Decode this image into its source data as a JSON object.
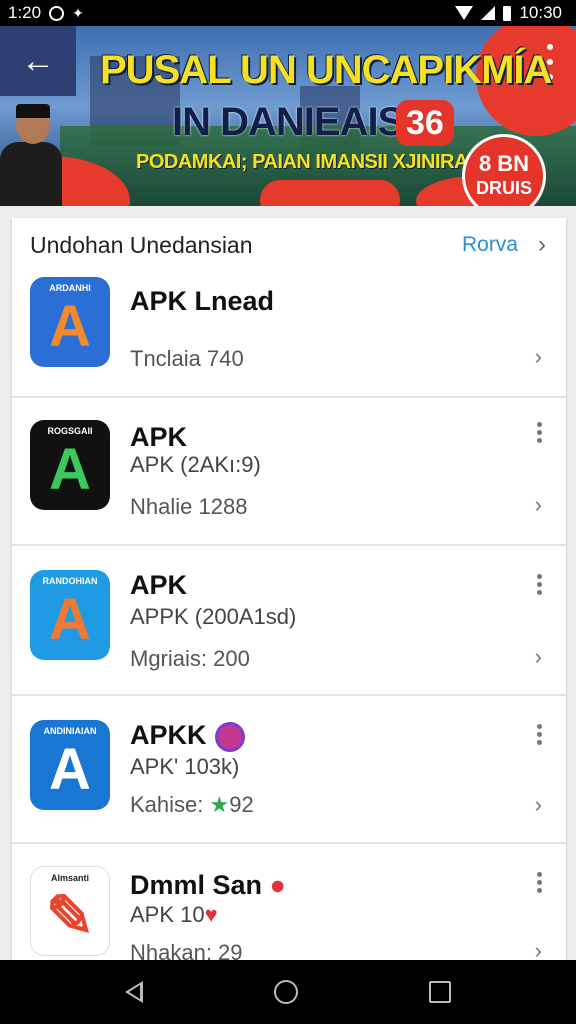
{
  "status_bar": {
    "time": "1:20",
    "clock_right": "10:30"
  },
  "banner": {
    "title": "PUSAL UN UNCAPIKMÍA",
    "subtitle": "IN DANIEAISA",
    "badge": "36",
    "tagline": "PODAMKAI; PAIAN IMANSII XJINIRAI",
    "seal_line1": "8 BN",
    "seal_line2": "DRUIS"
  },
  "section": {
    "title": "Undohan Unedansian",
    "link_label": "Rorva"
  },
  "apps": [
    {
      "icon_label": "ARDANHI",
      "name": "APK Lnead",
      "sub": "",
      "meta": "Tnclaia 740",
      "icon_bg": "#2a6fd6",
      "icon_fg": "#f28a2e",
      "glyph": "A",
      "show_menu": false,
      "name_badge": "",
      "meta_mark": ""
    },
    {
      "icon_label": "ROGSGAII",
      "name": "APK",
      "sub": "APK  (2AKı:9)",
      "meta": "Nhalie 1288",
      "icon_bg": "#111111",
      "icon_fg": "#3cc85a",
      "glyph": "A",
      "show_menu": true,
      "name_badge": "",
      "meta_mark": ""
    },
    {
      "icon_label": "RANDOHIAN",
      "name": "APK",
      "sub": "APPK  (200A1sd)",
      "meta": "Mgriais: 200",
      "icon_bg": "#1e9be3",
      "icon_fg": "#f07a32",
      "glyph": "A",
      "show_menu": true,
      "name_badge": "",
      "meta_mark": ""
    },
    {
      "icon_label": "ANDINIAIAN",
      "name": "APKK",
      "sub": "APK'  103k)",
      "meta": "Kahise: ",
      "meta_after": "92",
      "icon_bg": "#1976d2",
      "icon_fg": "#ffffff",
      "glyph": "A",
      "show_menu": true,
      "name_badge": "badge",
      "meta_mark": "★"
    },
    {
      "icon_label": "Almsanti",
      "name": "Dmml San",
      "sub": "APK  10",
      "meta": "Nhakan: 29",
      "icon_bg": "#ffffff",
      "icon_fg": "#e8452c",
      "glyph": "✎",
      "show_menu": true,
      "name_badge": "",
      "meta_mark": ""
    }
  ]
}
